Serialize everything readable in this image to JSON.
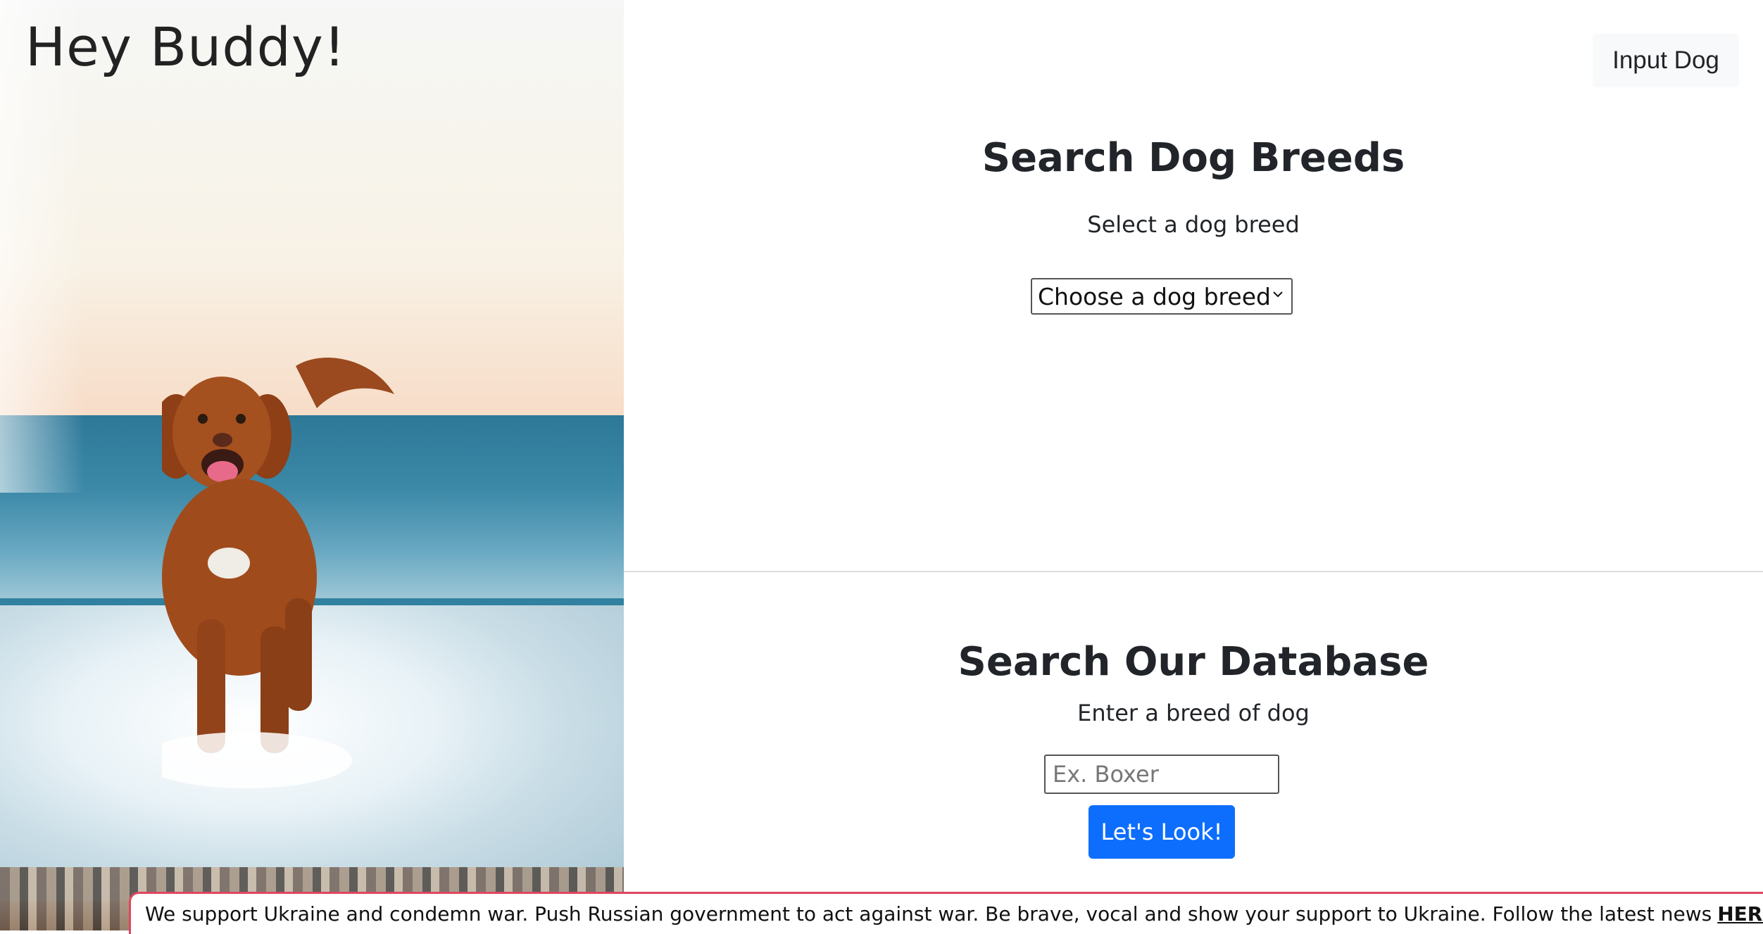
{
  "hero": {
    "title": "Hey Buddy!",
    "image": "dog running on beach photo"
  },
  "header": {
    "input_dog_label": "Input Dog"
  },
  "breed_search": {
    "title": "Search Dog Breeds",
    "subtitle": "Select a dog breed",
    "select_value": "Choose a dog breed"
  },
  "database_search": {
    "title": "Search Our Database",
    "subtitle": "Enter a breed of dog",
    "input_placeholder": "Ex. Boxer",
    "input_value": "",
    "submit_label": "Let's Look!"
  },
  "banner": {
    "text": "We support Ukraine and condemn war. Push Russian government to act against war. Be brave, vocal and show your support to Ukraine. Follow the latest news",
    "link_label": "HERE"
  },
  "colors": {
    "primary_button": "#0d6efd",
    "banner_border": "#e0465f",
    "secondary_button_bg": "#f8f9fa"
  },
  "icons": [
    "chevron-down-icon"
  ]
}
